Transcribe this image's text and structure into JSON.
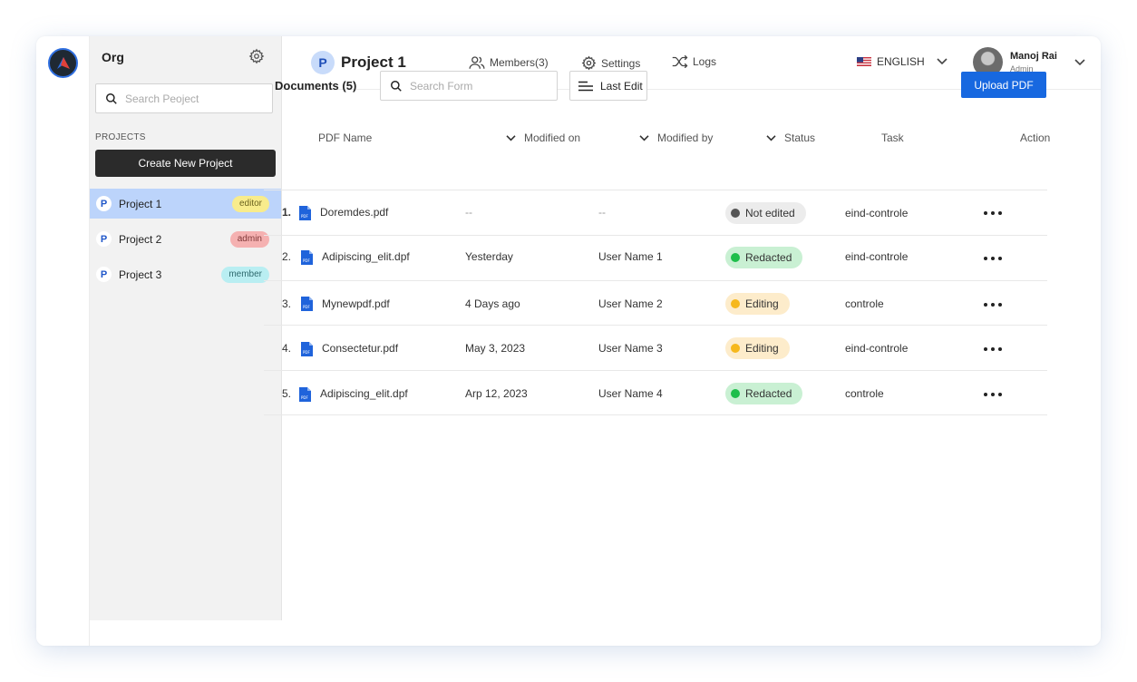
{
  "sidebar": {
    "org_title": "Org",
    "search_placeholder": "Search Peoject",
    "projects_label": "PROJECTS",
    "create_button": "Create New Project",
    "projects": [
      {
        "avatar": "P",
        "name": "Project 1",
        "role": "editor",
        "active": true
      },
      {
        "avatar": "P",
        "name": "Project 2",
        "role": "admin",
        "active": false
      },
      {
        "avatar": "P",
        "name": "Project 3",
        "role": "member",
        "active": false
      }
    ]
  },
  "header": {
    "project_avatar": "P",
    "project_title": "Project 1",
    "nav": {
      "members": "Members(3)",
      "settings": "Settings",
      "logs": "Logs"
    },
    "language": "ENGLISH",
    "user": {
      "name": "Manoj Rai",
      "role": "Admin"
    }
  },
  "documents": {
    "title": "Documents (5)",
    "search_placeholder": "Search Form",
    "sort_label": "Last Edit",
    "upload_button": "Upload PDF",
    "columns": {
      "pdf_name": "PDF Name",
      "modified_on": "Modified on",
      "modified_by": "Modified by",
      "status": "Status",
      "task": "Task",
      "action": "Action"
    },
    "rows": [
      {
        "num": "1.",
        "name": "Doremdes.pdf",
        "modified_on": "--",
        "modified_by": "--",
        "status": "Not edited",
        "task": "eind-controle"
      },
      {
        "num": "2.",
        "name": "Adipiscing_elit.dpf",
        "modified_on": "Yesterday",
        "modified_by": "User Name 1",
        "status": "Redacted",
        "task": "eind-controle"
      },
      {
        "num": "3.",
        "name": "Mynewpdf.pdf",
        "modified_on": "4 Days ago",
        "modified_by": "User Name 2",
        "status": "Editing",
        "task": "controle"
      },
      {
        "num": "4.",
        "name": "Consectetur.pdf",
        "modified_on": "May 3, 2023",
        "modified_by": "User Name 3",
        "status": "Editing",
        "task": "eind-controle"
      },
      {
        "num": "5.",
        "name": "Adipiscing_elit.dpf",
        "modified_on": "Arp 12, 2023",
        "modified_by": "User Name 4",
        "status": "Redacted",
        "task": "controle"
      }
    ]
  },
  "colors": {
    "accent": "#1768e0",
    "active_project_bg": "#bcd4fb",
    "status_redacted": "#1ebe4b",
    "status_editing": "#f6b81c",
    "status_not_edited": "#555555"
  }
}
